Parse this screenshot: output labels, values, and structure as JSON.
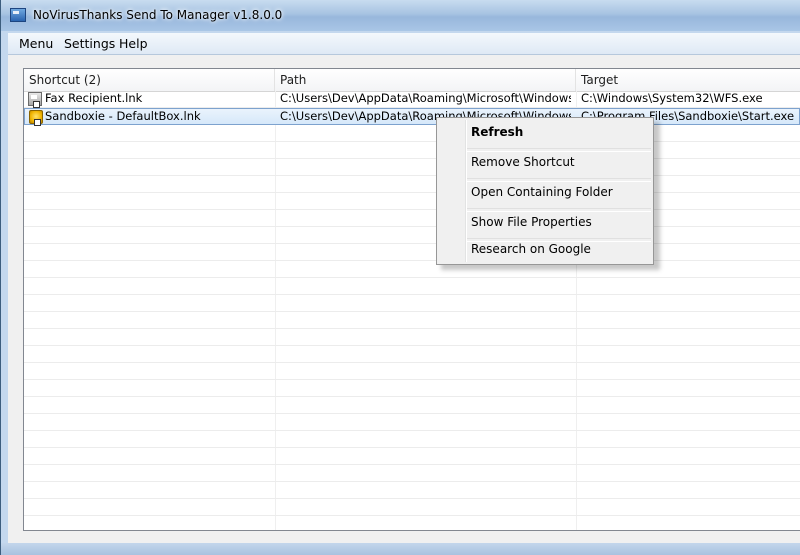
{
  "window": {
    "title": "NoVirusThanks Send To Manager v1.8.0.0",
    "icon": "app-window-icon"
  },
  "menubar": {
    "items": [
      "Menu",
      "Settings",
      "Help"
    ]
  },
  "list": {
    "columns": [
      "Shortcut (2)",
      "Path",
      "Target"
    ],
    "rows": [
      {
        "icon": "fax-shortcut-icon",
        "shortcut": "Fax Recipient.lnk",
        "path": "C:\\Users\\Dev\\AppData\\Roaming\\Microsoft\\Windows\\Sen...",
        "target": "C:\\Windows\\System32\\WFS.exe",
        "selected": false
      },
      {
        "icon": "sandboxie-shortcut-icon",
        "shortcut": "Sandboxie - DefaultBox.lnk",
        "path": "C:\\Users\\Dev\\AppData\\Roaming\\Microsoft\\Windows\\Sen...",
        "target": "C:\\Program Files\\Sandboxie\\Start.exe",
        "selected": true
      }
    ]
  },
  "context_menu": {
    "items": [
      "Refresh",
      "Remove  Shortcut",
      "Open Containing Folder",
      "Show File Properties",
      "Research on Google"
    ],
    "default_item": "Refresh"
  },
  "colors": {
    "selection": "#d6e8fa",
    "selection_border": "#7da2ce",
    "menu_background": "#f0f0f0"
  }
}
